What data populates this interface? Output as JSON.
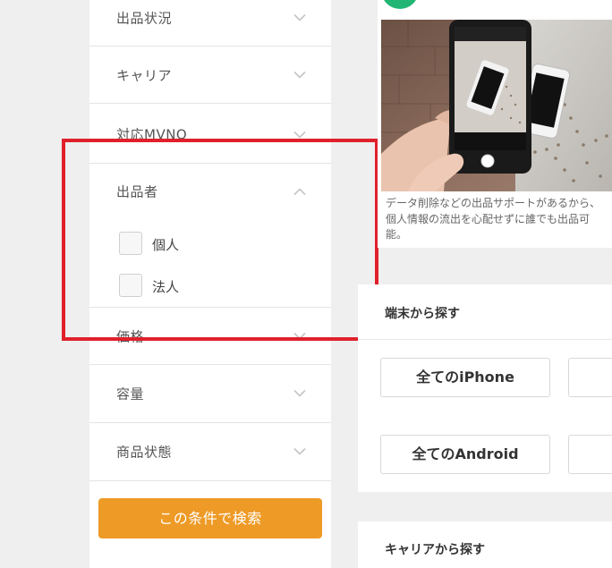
{
  "filters": {
    "rows": [
      {
        "label": "出品状況",
        "state": "collapsed"
      },
      {
        "label": "キャリア",
        "state": "collapsed"
      },
      {
        "label": "対応MVNO",
        "state": "collapsed"
      },
      {
        "label": "出品者",
        "state": "expanded"
      },
      {
        "label": "価格",
        "state": "collapsed"
      },
      {
        "label": "容量",
        "state": "collapsed"
      },
      {
        "label": "商品状態",
        "state": "collapsed"
      }
    ],
    "seller_options": [
      {
        "label": "個人",
        "checked": false
      },
      {
        "label": "法人",
        "checked": false
      }
    ],
    "search_button": "この条件で検索"
  },
  "promo": {
    "caption": "データ削除などの出品サポートがあるから、個人情報の流出を心配せずに誰でも出品可能。"
  },
  "device_section": {
    "title": "端末から探す",
    "buttons": [
      "全てのiPhone",
      "全てのAndroid"
    ]
  },
  "carrier_section": {
    "title": "キャリアから探す"
  },
  "colors": {
    "accent": "#ee9a26",
    "highlight": "#e0212b",
    "brand_green": "#22b573"
  }
}
